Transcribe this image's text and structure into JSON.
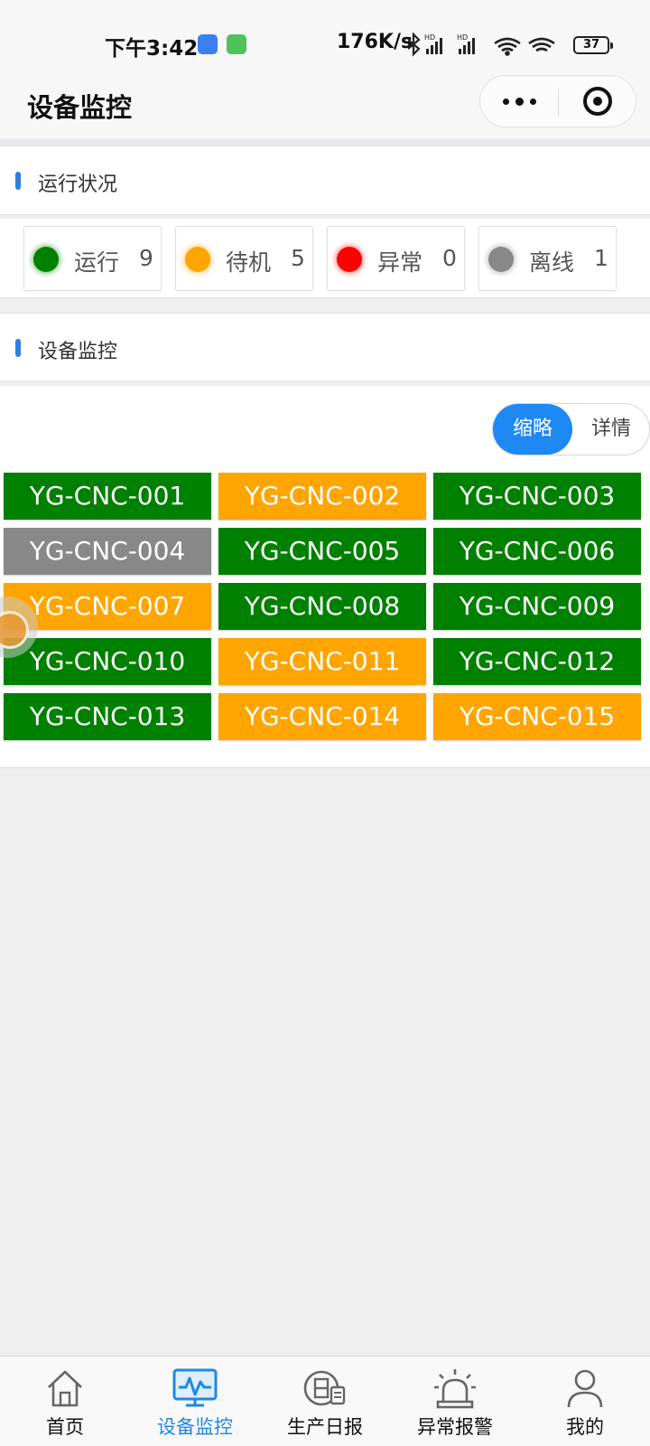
{
  "status_bar": {
    "time": "下午3:42",
    "net_speed": "176K/s",
    "battery": "37"
  },
  "nav": {
    "title": "设备监控"
  },
  "running_status": {
    "heading": "运行状况",
    "items": [
      {
        "label": "运行",
        "count": "9",
        "color": "#008000"
      },
      {
        "label": "待机",
        "count": "5",
        "color": "#FFA500"
      },
      {
        "label": "异常",
        "count": "0",
        "color": "#FF0000"
      },
      {
        "label": "离线",
        "count": "1",
        "color": "#888888"
      }
    ]
  },
  "monitor": {
    "heading": "设备监控",
    "view_toggle": {
      "active": "缩略",
      "inactive": "详情"
    },
    "devices": [
      {
        "id": "YG-CNC-001",
        "status": "运行",
        "color": "#008000"
      },
      {
        "id": "YG-CNC-002",
        "status": "待机",
        "color": "#FFA500"
      },
      {
        "id": "YG-CNC-003",
        "status": "运行",
        "color": "#008000"
      },
      {
        "id": "YG-CNC-004",
        "status": "离线",
        "color": "#888888"
      },
      {
        "id": "YG-CNC-005",
        "status": "运行",
        "color": "#008000"
      },
      {
        "id": "YG-CNC-006",
        "status": "运行",
        "color": "#008000"
      },
      {
        "id": "YG-CNC-007",
        "status": "待机",
        "color": "#FFA500"
      },
      {
        "id": "YG-CNC-008",
        "status": "运行",
        "color": "#008000"
      },
      {
        "id": "YG-CNC-009",
        "status": "运行",
        "color": "#008000"
      },
      {
        "id": "YG-CNC-010",
        "status": "运行",
        "color": "#008000"
      },
      {
        "id": "YG-CNC-011",
        "status": "待机",
        "color": "#FFA500"
      },
      {
        "id": "YG-CNC-012",
        "status": "运行",
        "color": "#008000"
      },
      {
        "id": "YG-CNC-013",
        "status": "运行",
        "color": "#008000"
      },
      {
        "id": "YG-CNC-014",
        "status": "待机",
        "color": "#FFA500"
      },
      {
        "id": "YG-CNC-015",
        "status": "待机",
        "color": "#FFA500"
      }
    ]
  },
  "tabbar": {
    "active_color": "#1e88e5",
    "tabs": [
      {
        "label": "首页",
        "icon": "home-icon"
      },
      {
        "label": "设备监控",
        "icon": "monitor-icon"
      },
      {
        "label": "生产日报",
        "icon": "daily-report-icon"
      },
      {
        "label": "异常报警",
        "icon": "alarm-icon"
      },
      {
        "label": "我的",
        "icon": "user-icon"
      }
    ]
  }
}
